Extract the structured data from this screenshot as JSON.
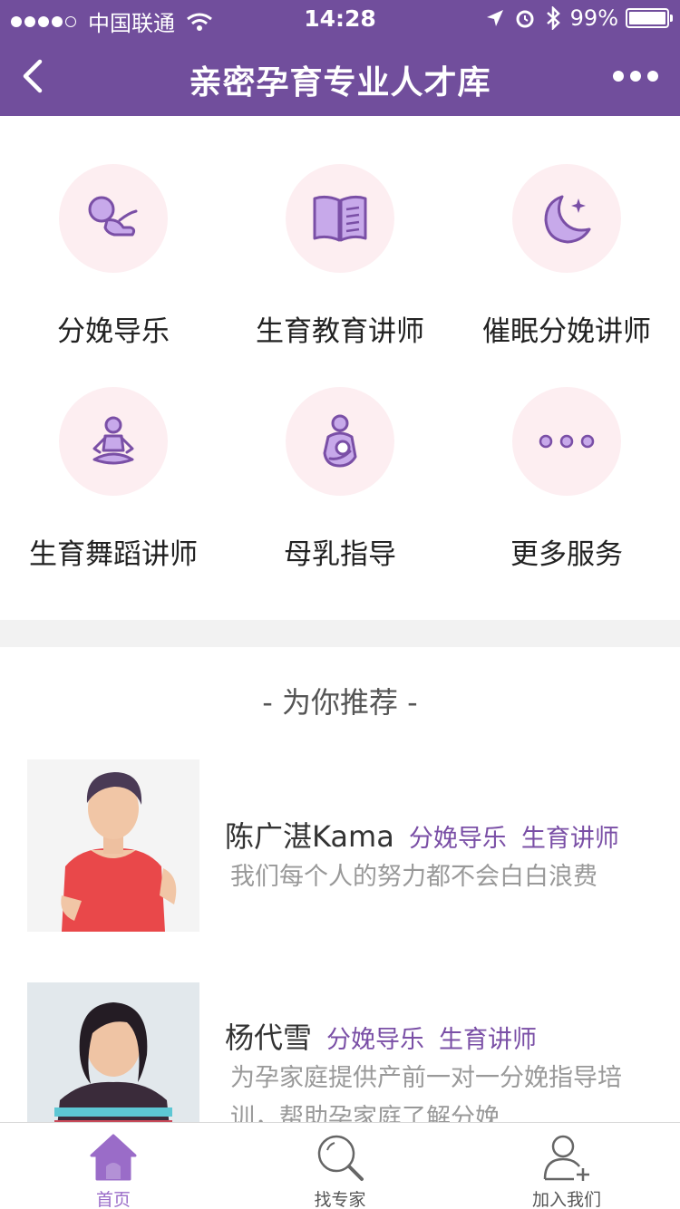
{
  "status": {
    "carrier": "中国联通",
    "time": "14:28",
    "battery": "99%"
  },
  "nav": {
    "title": "亲密孕育专业人才库"
  },
  "services": [
    {
      "label": "分娩导乐",
      "icon": "baby-icon"
    },
    {
      "label": "生育教育讲师",
      "icon": "book-icon"
    },
    {
      "label": "催眠分娩讲师",
      "icon": "moon-icon"
    },
    {
      "label": "生育舞蹈讲师",
      "icon": "meditation-icon"
    },
    {
      "label": "母乳指导",
      "icon": "breastfeeding-icon"
    },
    {
      "label": "更多服务",
      "icon": "more-dots-icon"
    }
  ],
  "recommend": {
    "title": "- 为你推荐 -",
    "items": [
      {
        "name": "陈广湛Kama",
        "tags": [
          "分娩导乐",
          "生育讲师"
        ],
        "desc": "我们每个人的努力都不会白白浪费"
      },
      {
        "name": "杨代雪",
        "tags": [
          "分娩导乐",
          "生育讲师"
        ],
        "desc": "为孕家庭提供产前一对一分娩指导培训，帮助孕家庭了解分娩"
      }
    ]
  },
  "tabbar": [
    {
      "label": "首页",
      "active": true
    },
    {
      "label": "找专家",
      "active": false
    },
    {
      "label": "加入我们",
      "active": false
    }
  ],
  "colors": {
    "brand": "#714e9c",
    "accent": "#9a6cc8",
    "tag": "#7a4fa6",
    "icon_bg": "#fdeef1"
  }
}
